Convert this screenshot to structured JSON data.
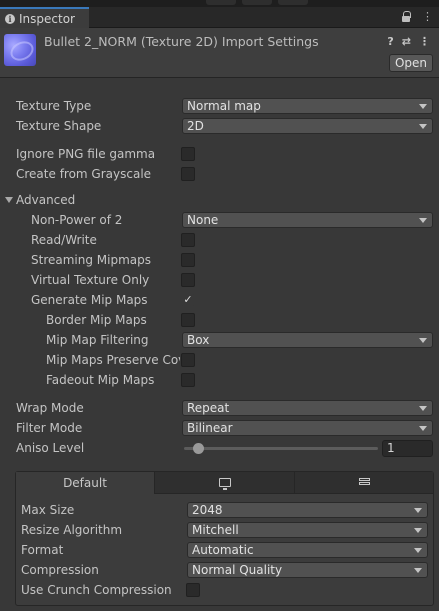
{
  "window": {
    "tab_label": "Inspector"
  },
  "header": {
    "title": "Bullet 2_NORM (Texture 2D) Import Settings",
    "open_button": "Open",
    "help_icon": "?",
    "preset_icon": "⇄",
    "menu_icon": "⋮"
  },
  "fields": {
    "texture_type": {
      "label": "Texture Type",
      "value": "Normal map"
    },
    "texture_shape": {
      "label": "Texture Shape",
      "value": "2D"
    },
    "ignore_png_gamma": {
      "label": "Ignore PNG file gamma",
      "checked": false
    },
    "create_from_grayscale": {
      "label": "Create from Grayscale",
      "checked": false
    },
    "advanced": {
      "label": "Advanced",
      "expanded": true
    },
    "non_power_of_2": {
      "label": "Non-Power of 2",
      "value": "None"
    },
    "read_write": {
      "label": "Read/Write",
      "checked": false
    },
    "streaming_mipmaps": {
      "label": "Streaming Mipmaps",
      "checked": false
    },
    "virtual_texture_only": {
      "label": "Virtual Texture Only",
      "checked": false
    },
    "generate_mip_maps": {
      "label": "Generate Mip Maps",
      "checked": true,
      "check_glyph": "✓"
    },
    "border_mip_maps": {
      "label": "Border Mip Maps",
      "checked": false
    },
    "mip_map_filtering": {
      "label": "Mip Map Filtering",
      "value": "Box"
    },
    "mip_maps_preserve_coverage": {
      "label": "Mip Maps Preserve Cov",
      "checked": false
    },
    "fadeout_mip_maps": {
      "label": "Fadeout Mip Maps",
      "checked": false
    },
    "wrap_mode": {
      "label": "Wrap Mode",
      "value": "Repeat"
    },
    "filter_mode": {
      "label": "Filter Mode",
      "value": "Bilinear"
    },
    "aniso_level": {
      "label": "Aniso Level",
      "value": "1",
      "slider_fraction": 0.0
    }
  },
  "platform": {
    "tabs": [
      {
        "label": "Default",
        "icon": null,
        "active": true
      },
      {
        "label": "",
        "icon": "monitor-icon",
        "active": false
      },
      {
        "label": "",
        "icon": "server-icon",
        "active": false
      }
    ],
    "max_size": {
      "label": "Max Size",
      "value": "2048"
    },
    "resize_algorithm": {
      "label": "Resize Algorithm",
      "value": "Mitchell"
    },
    "format": {
      "label": "Format",
      "value": "Automatic"
    },
    "compression": {
      "label": "Compression",
      "value": "Normal Quality"
    },
    "use_crunch": {
      "label": "Use Crunch Compression",
      "checked": false
    }
  },
  "colors": {
    "background": "#383838",
    "tab_accent": "#3a79bb",
    "dropdown": "#515151",
    "checkbox": "#2a2a2a"
  }
}
